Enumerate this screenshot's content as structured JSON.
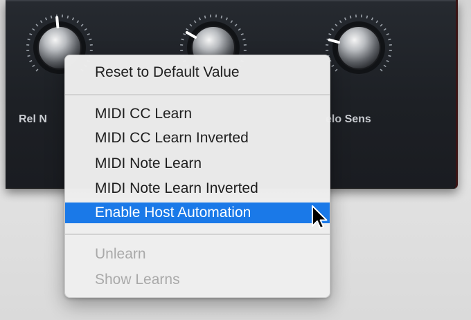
{
  "plugin": {
    "knobs": [
      {
        "name": "rel-knob",
        "label": "Rel N",
        "pointer_angle": -5
      },
      {
        "name": "center-knob",
        "label": "",
        "pointer_angle": -60
      },
      {
        "name": "velo-sens-knob",
        "label": "elo Sens",
        "pointer_angle": -75
      }
    ]
  },
  "context_menu": {
    "items": [
      {
        "label": "Reset to Default Value",
        "state": "enabled"
      },
      {
        "label": "MIDI CC Learn",
        "state": "enabled"
      },
      {
        "label": "MIDI CC Learn Inverted",
        "state": "enabled"
      },
      {
        "label": "MIDI Note Learn",
        "state": "enabled"
      },
      {
        "label": "MIDI Note Learn Inverted",
        "state": "enabled"
      },
      {
        "label": "Enable Host Automation",
        "state": "highlighted"
      },
      {
        "label": "Unlearn",
        "state": "disabled"
      },
      {
        "label": "Show Learns",
        "state": "disabled"
      }
    ]
  },
  "colors": {
    "panel_background": "#1d2025",
    "menu_background": "#eeeeee",
    "highlight": "#1a79e8",
    "disabled_text": "#a9a9a9",
    "knob_label": "#c9ccd1"
  },
  "cursor": {
    "icon": "arrow-pointer-icon"
  }
}
